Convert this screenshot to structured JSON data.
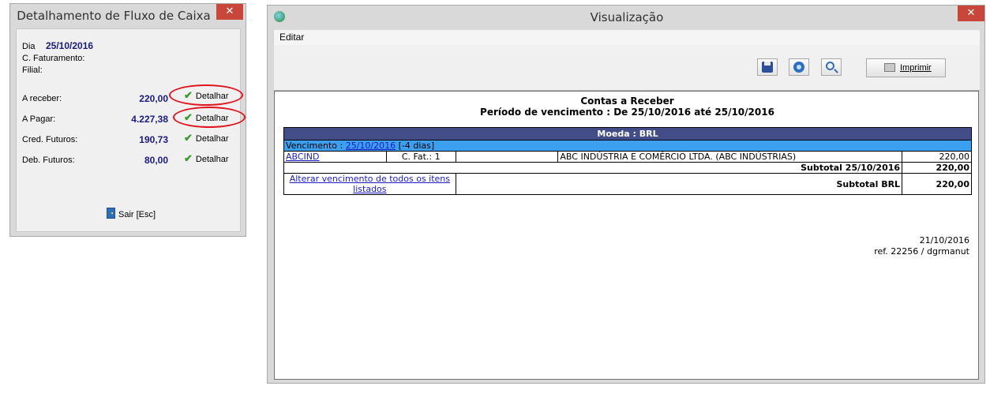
{
  "left_dialog": {
    "title": "Detalhamento de Fluxo de Caixa",
    "close_symbol": "✕",
    "dia_label": "Dia",
    "dia_value": "25/10/2016",
    "c_faturamento_label": "C. Faturamento:",
    "filial_label": "Filial:",
    "rows": [
      {
        "label": "A receber:",
        "value": "220,00",
        "action": "Detalhar"
      },
      {
        "label": "A Pagar:",
        "value": "4.227,38",
        "action": "Detalhar"
      },
      {
        "label": "Cred. Futuros:",
        "value": "190,73",
        "action": "Detalhar"
      },
      {
        "label": "Deb. Futuros:",
        "value": "80,00",
        "action": "Detalhar"
      }
    ],
    "exit_label": "Sair [Esc]"
  },
  "right_window": {
    "title": "Visualização",
    "close_symbol": "✕",
    "menu": [
      "Editar"
    ],
    "toolbar": {
      "icons": [
        "save-icon",
        "refresh-icon",
        "zoom-icon"
      ],
      "print_label": "Imprimir"
    },
    "report": {
      "title": "Contas a Receber",
      "subtitle": "Período de vencimento : De 25/10/2016 até 25/10/2016",
      "currency_header": "Moeda : BRL",
      "vencimento_label": "Vencimento :",
      "vencimento_date": "25/10/2016",
      "vencimento_days": "[-4 dias]",
      "row": {
        "code": "ABCIND",
        "cfat": "C. Fat.: 1",
        "description": "ABC INDÚSTRIA E COMÉRCIO LTDA. (ABC INDÚSTRIAS)",
        "amount": "220,00"
      },
      "subtotal_date_label": "Subtotal 25/10/2016",
      "subtotal_date_value": "220,00",
      "alterar_link": "Alterar vencimento de todos os itens listados",
      "subtotal_currency_label": "Subtotal BRL",
      "subtotal_currency_value": "220,00",
      "footer_date": "21/10/2016",
      "footer_ref": "ref. 22256 / dgrmanut"
    }
  },
  "colors": {
    "close_button": "#c8473a",
    "highlight_ring": "#e0141e",
    "value_text": "#1a1a80",
    "currency_header_bg": "#434e88",
    "vencimento_bg": "#3d9ff0"
  }
}
